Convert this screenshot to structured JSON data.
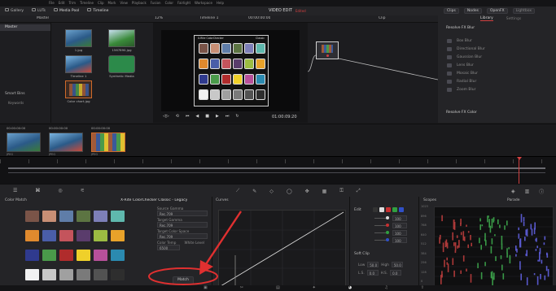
{
  "menubar": {
    "items": [
      "File",
      "Edit",
      "Trim",
      "Timeline",
      "Clip",
      "Mark",
      "View",
      "Playback",
      "Fusion",
      "Color",
      "Fairlight",
      "Workspace",
      "Help"
    ]
  },
  "toolbar": {
    "left": [
      "Gallery",
      "LUTs",
      "Media Pool",
      "Timeline"
    ],
    "center_title": "VIDEO EDIT",
    "center_badge": "Edited",
    "right": [
      "Clips",
      "Nodes",
      "OpenFX",
      "Lightbox"
    ]
  },
  "media_header": {
    "bin": "Master",
    "zoom": "12%",
    "timeline_name": "Timeline 1",
    "timecode_left": "00:00:00:00",
    "clip_label": "Clip"
  },
  "sidebar": {
    "master": "Master",
    "smart_bins": "Smart Bins",
    "keywords": "Keywords"
  },
  "media_pool": {
    "clips": [
      {
        "name": "1.jpg",
        "color": "#3a6e9a"
      },
      {
        "name": "1567890.jpg",
        "color": "#3b8a3a"
      },
      {
        "name": "Timeline 1",
        "color": "#4a7fb0"
      },
      {
        "name": "Synthetic Media",
        "color": "#5a9a50"
      },
      {
        "name": "Color chart.jpg",
        "color": "#8a5a3a"
      }
    ]
  },
  "viewer": {
    "chart_title": "X-Rite ColorChecker",
    "chart_brand": "Classic",
    "timecode": "01:00:09:20"
  },
  "library": {
    "tabs": [
      "Library",
      "Settings"
    ],
    "section1": "Resolve FX Blur",
    "items": [
      "Box Blur",
      "Directional Blur",
      "Gaussian Blur",
      "Lens Blur",
      "Mosaic Blur",
      "Radial Blur",
      "Zoom Blur"
    ],
    "section2": "Resolve FX Color"
  },
  "clips_strip": {
    "clips": [
      {
        "tc": "00:00:00:00",
        "track": "V1",
        "label": "JPEG"
      },
      {
        "tc": "00:00:00:00",
        "track": "V1",
        "label": "JPEG"
      },
      {
        "tc": "00:00:00:00",
        "track": "V1",
        "label": "JPEG"
      }
    ]
  },
  "color_match": {
    "title": "Color Match",
    "chart_select": "X-Rite ColorChecker Classic - Legacy",
    "curves_title": "Curves",
    "custom_label": "Custom",
    "source_gamma_label": "Source Gamma",
    "source_gamma": "Rec.709",
    "target_gamma_label": "Target Gamma",
    "target_gamma": "Rec.709",
    "target_color_space_label": "Target Color Space",
    "target_color_space": "Rec.709",
    "color_temp_label": "Color Temp",
    "color_temp": "6500",
    "white_level_label": "White Level",
    "match_button": "Match"
  },
  "edit_panel": {
    "title": "Edit",
    "values": [
      "100",
      "100",
      "100",
      "100"
    ],
    "soft_clip": "Soft Clip",
    "low_label": "Low",
    "low_value": "50.0",
    "high_label": "High",
    "high_value": "50.0",
    "ls_label": "L.S.",
    "ls_value": "0.0",
    "hs_label": "H.S.",
    "hs_value": "0.0"
  },
  "scopes": {
    "title": "Scopes",
    "mode": "Parade",
    "ticks": [
      "1023",
      "896",
      "768",
      "640",
      "512",
      "384",
      "256",
      "128",
      "0"
    ]
  },
  "colors": {
    "accent_red": "#d04040",
    "annotation_red": "#e03030",
    "panel": "#242427"
  },
  "swatches": [
    [
      "#7a5448",
      "#c88f75",
      "#5f7da8",
      "#5c7442",
      "#7d7fb8",
      "#5fb8ad"
    ],
    [
      "#e08a2e",
      "#4a5ea8",
      "#c4545c",
      "#5a3c6c",
      "#9cbc42",
      "#e8a22a"
    ],
    [
      "#2f3a8e",
      "#4a9a4a",
      "#b02c2c",
      "#efd02a",
      "#b8509a",
      "#2b8ab0"
    ],
    [
      "#f2f2f2",
      "#c8c8c8",
      "#a0a0a0",
      "#7a7a7a",
      "#525252",
      "#2e2e2e"
    ]
  ]
}
